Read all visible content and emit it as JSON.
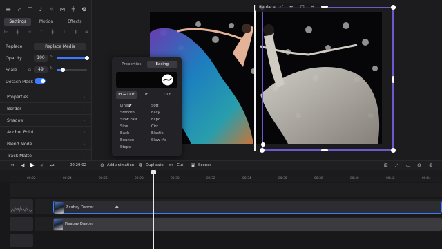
{
  "colors": {
    "accent": "#3a7bff",
    "selection": "#6a5acd",
    "panel": "#1f1f22"
  },
  "left_panel": {
    "icons": [
      "folder-icon",
      "rocket-icon",
      "text-icon",
      "audio-icon",
      "magic-icon",
      "transition-icon",
      "split-icon",
      "gear-icon"
    ],
    "tabs": [
      {
        "label": "Settings",
        "active": true
      },
      {
        "label": "Motion",
        "active": false
      },
      {
        "label": "Effects",
        "active": false
      }
    ],
    "align_icons": [
      "align-left-icon",
      "align-center-h-icon",
      "align-right-icon",
      "align-top-icon",
      "align-center-v-icon",
      "align-bottom-icon",
      "distribute-h-icon",
      "distribute-v-icon"
    ],
    "replace_label": "Replace",
    "replace_button": "Replace Media",
    "opacity": {
      "label": "Opacity",
      "value": "100",
      "unit": "%",
      "fraction": 1.0
    },
    "scale": {
      "label": "Scale",
      "value": "49",
      "unit": "%",
      "fraction": 0.2
    },
    "detach_mask": {
      "label": "Detach Mask",
      "on": true
    },
    "sections": [
      "Properties",
      "Border",
      "Shadow",
      "Anchor Point",
      "Blend Mode",
      "Track Matte"
    ]
  },
  "canvas": {
    "toolbar": {
      "replace_label": "Replace"
    }
  },
  "popup": {
    "tabs": [
      {
        "label": "Properties",
        "active": false
      },
      {
        "label": "Easing",
        "active": true
      }
    ],
    "easing_modes": [
      {
        "label": "In & Out",
        "active": true
      },
      {
        "label": "In",
        "active": false
      },
      {
        "label": "Out",
        "active": false
      }
    ],
    "easing_col1": [
      "Linear",
      "Smooth",
      "Slow Fast",
      "Sine",
      "Back",
      "Bounce",
      "Steps"
    ],
    "easing_col2": [
      "Soft",
      "Easy",
      "Expo",
      "Circ",
      "Elastic",
      "Slow Mo"
    ]
  },
  "toolbar": {
    "time": "00:29.02",
    "add_animation": "Add animation",
    "duplicate": "Duplicate",
    "cut": "Cut",
    "scenes": "Scenes"
  },
  "ruler_ticks": [
    "00:22",
    "00:24",
    "00:26",
    "00:28",
    "00:30",
    "00:32",
    "00:34",
    "00:36",
    "00:38",
    "00:40",
    "00:42",
    "00:44"
  ],
  "clips": [
    {
      "label": "Pixabay Dancer",
      "selected": true
    },
    {
      "label": "Pixabay Dancer",
      "selected": false
    }
  ]
}
